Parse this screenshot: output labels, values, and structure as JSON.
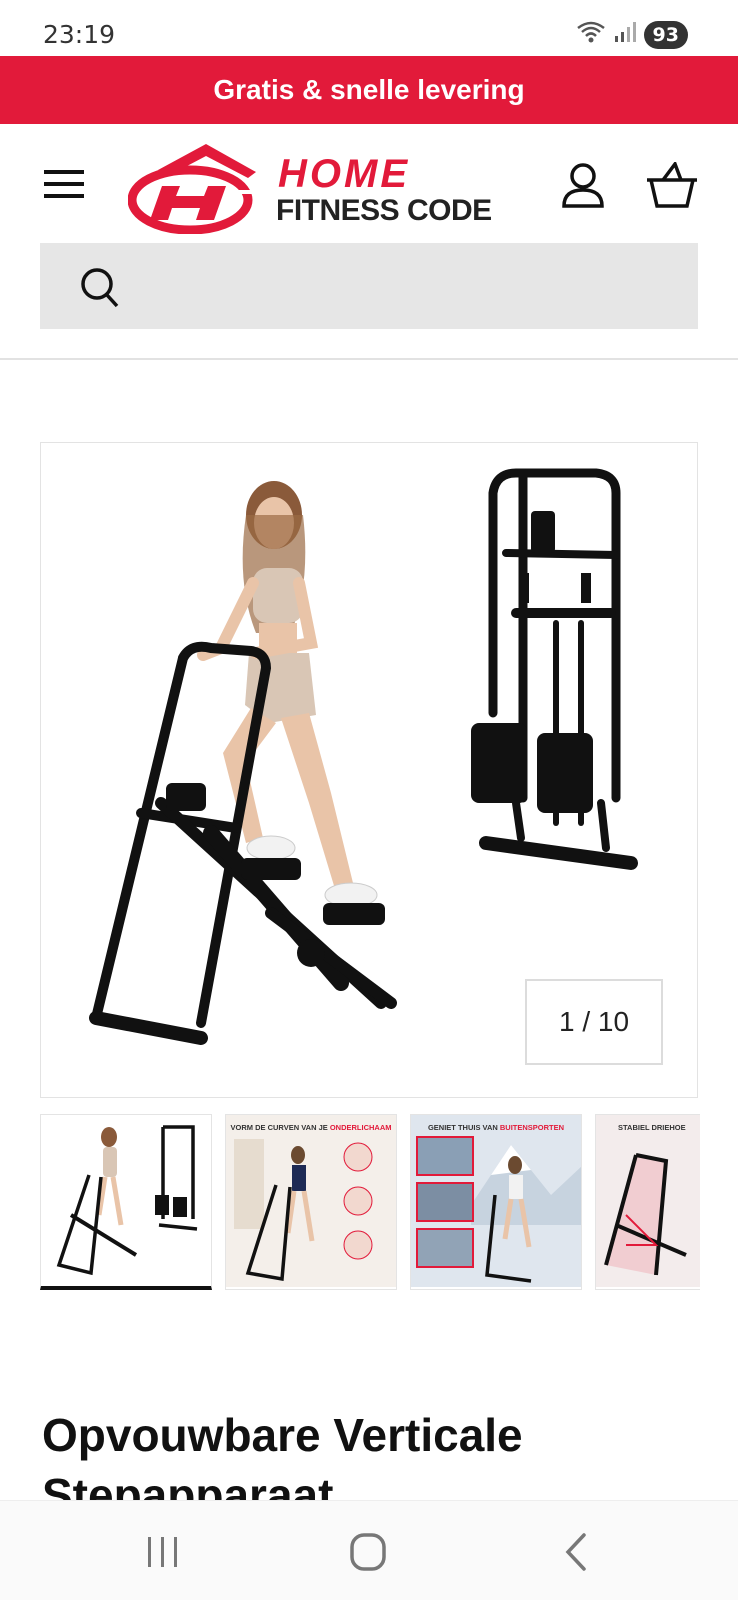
{
  "status_bar": {
    "time": "23:19",
    "battery": "93"
  },
  "promo": {
    "text": "Gratis & snelle levering"
  },
  "header": {
    "logo_home": "HOME",
    "logo_sub": "FITNESS CODE"
  },
  "search": {
    "placeholder": ""
  },
  "gallery": {
    "counter": "1 / 10",
    "thumbnails": [
      {
        "caption": "",
        "caption_highlight": ""
      },
      {
        "caption": "VORM DE CURVEN VAN JE ",
        "caption_highlight": "ONDERLICHAAM"
      },
      {
        "caption": "GENIET THUIS VAN ",
        "caption_highlight": "BUITENSPORTEN"
      },
      {
        "caption": "STABIEL DRIEHOE",
        "caption_highlight": ""
      }
    ]
  },
  "product": {
    "title": "Opvouwbare Verticale Stepapparaat"
  },
  "colors": {
    "brand_red": "#e21a3a",
    "search_bg": "#e6e6e6"
  },
  "icons": [
    "wifi-icon",
    "signal-icon",
    "menu-icon",
    "account-icon",
    "cart-icon",
    "search-icon",
    "recent-apps-icon",
    "home-icon",
    "back-icon"
  ]
}
